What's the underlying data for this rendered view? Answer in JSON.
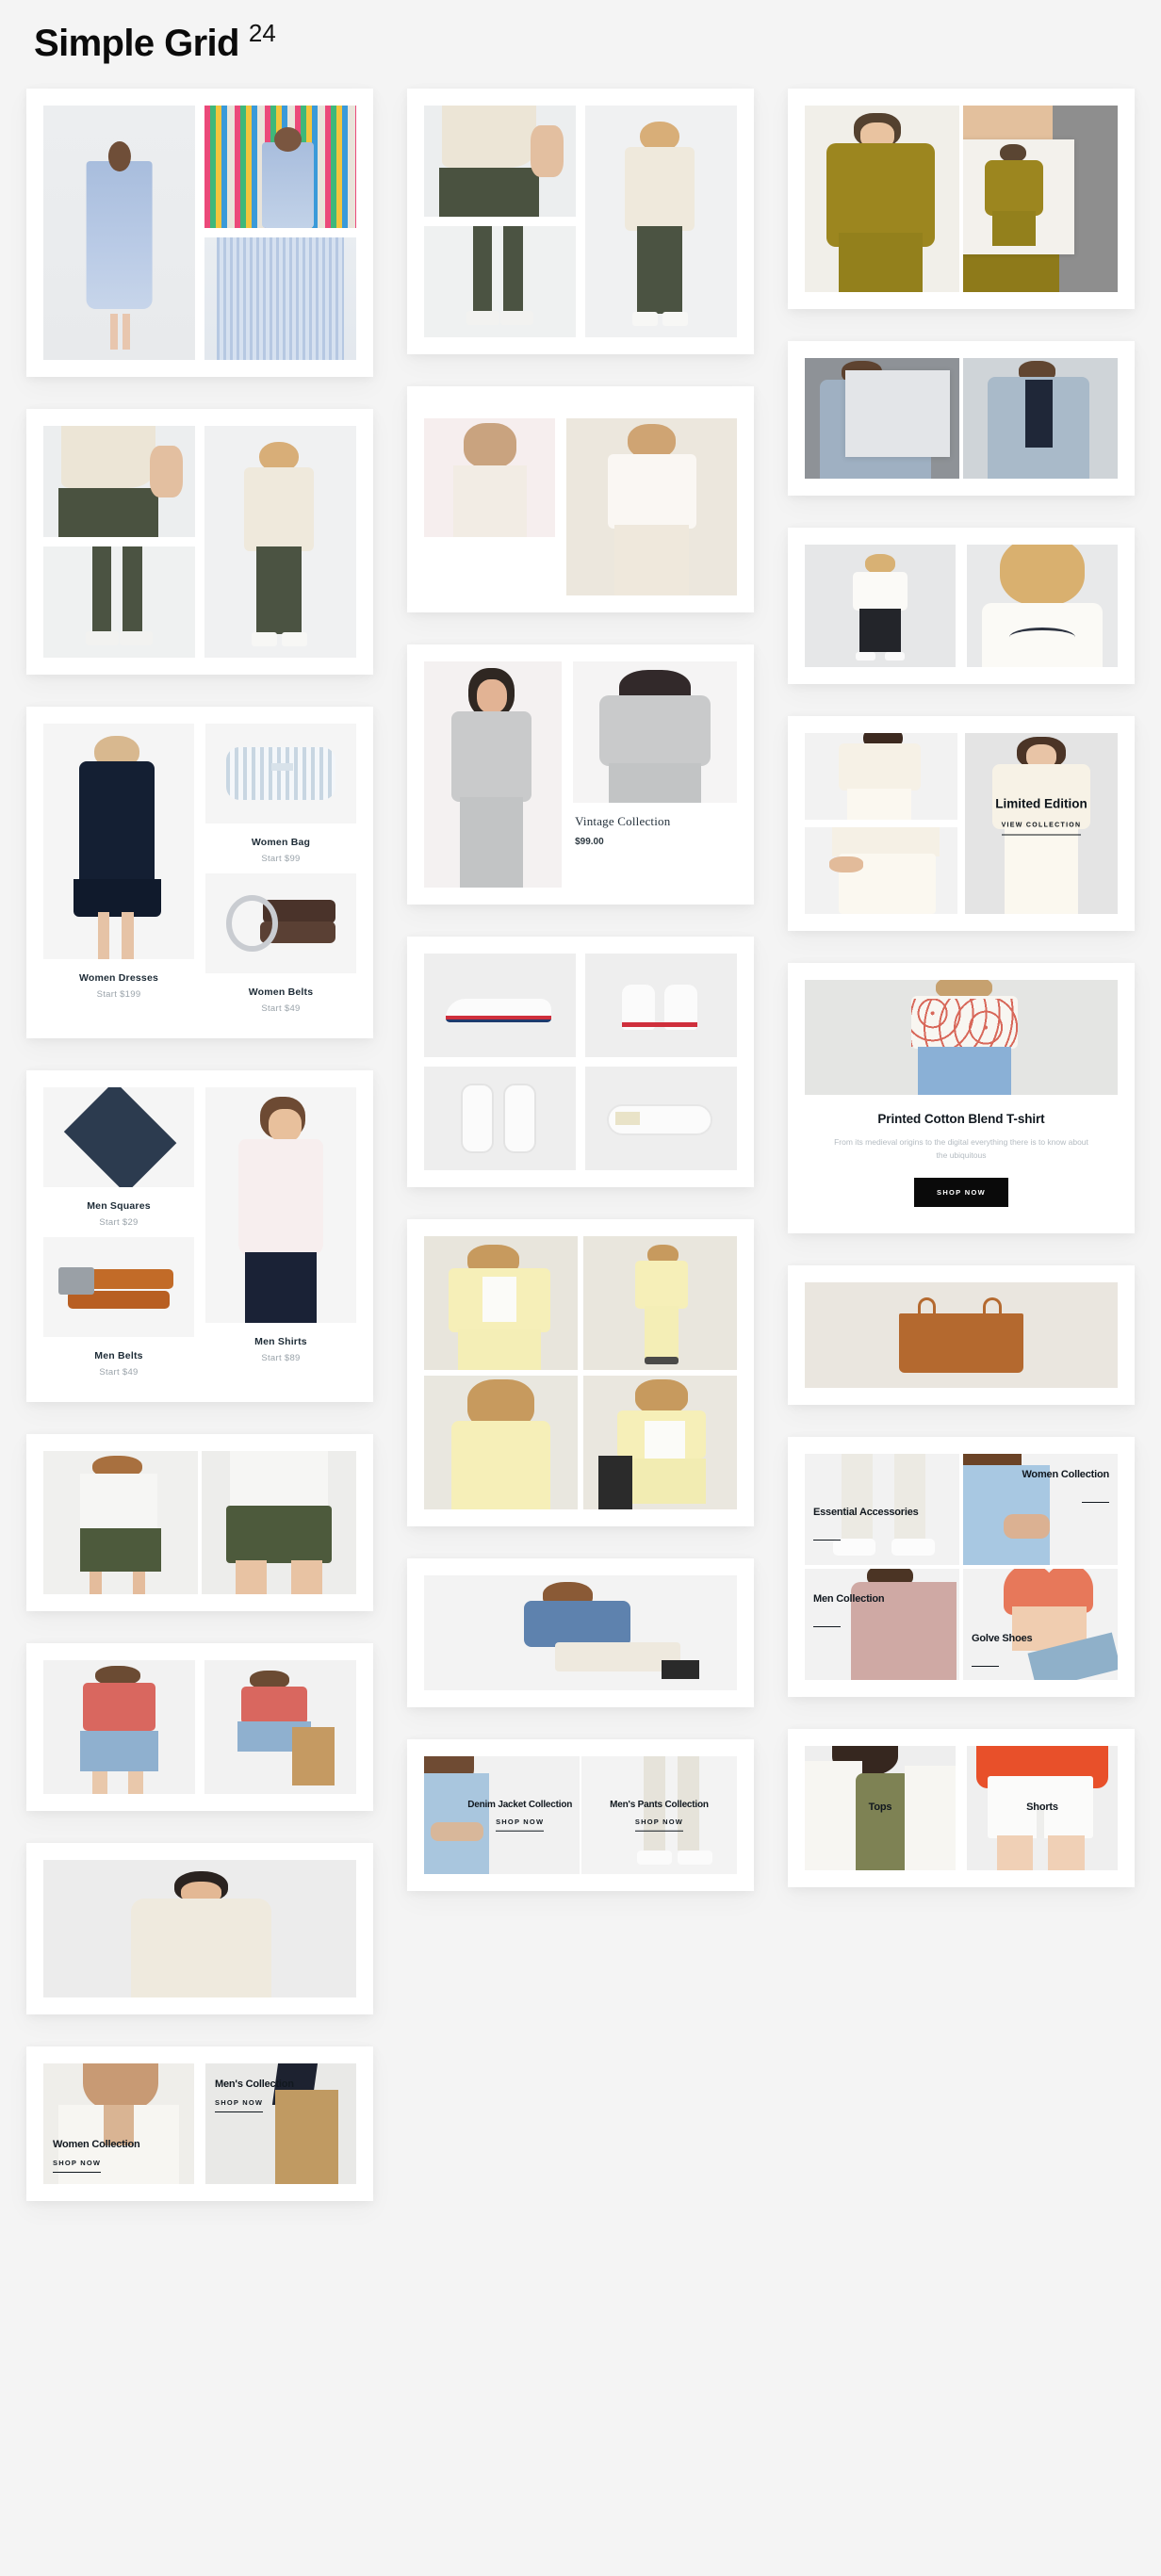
{
  "header": {
    "title": "Simple Grid",
    "superscript": "24"
  },
  "theme": {
    "page_background": "#f4f4f4",
    "card_background": "#ffffff",
    "text_primary": "#11181f",
    "text_muted": "#9aa3aa",
    "button_background": "#0a0a0a",
    "button_text": "#ffffff"
  },
  "columns": [
    {
      "name": "column-1",
      "cards": [
        {
          "id": "girls-dress-gallery",
          "layout": "split-left-tall"
        },
        {
          "id": "boys-olive-pants-gallery",
          "layout": "split-left-stack"
        },
        {
          "id": "women-essentials",
          "layout": "captioned-trio",
          "items": [
            {
              "title": "Women Dresses",
              "price": "Start $199"
            },
            {
              "title": "Women Bag",
              "price": "Start $99"
            },
            {
              "title": "Women Belts",
              "price": "Start $49"
            }
          ]
        },
        {
          "id": "men-essentials",
          "layout": "captioned-trio",
          "items": [
            {
              "title": "Men Squares",
              "price": "Start $29"
            },
            {
              "title": "Men Belts",
              "price": "Start $49"
            },
            {
              "title": "Men Shirts",
              "price": "Start $89"
            }
          ]
        },
        {
          "id": "olive-shorts-pair",
          "layout": "two-up"
        },
        {
          "id": "denim-skirt-pair",
          "layout": "two-up"
        },
        {
          "id": "cream-hoodie-single",
          "layout": "single"
        },
        {
          "id": "collection-split-women-men",
          "layout": "two-up-overlay",
          "items": [
            {
              "title": "Women Collection",
              "link": "SHOP NOW"
            },
            {
              "title": "Men's Collection",
              "link": "SHOP NOW"
            }
          ]
        }
      ]
    },
    {
      "name": "column-2",
      "cards": [
        {
          "id": "olive-pants-gallery-alt",
          "layout": "split-stack-right"
        },
        {
          "id": "blush-blouse-pair",
          "layout": "two-up-uneven"
        },
        {
          "id": "vintage-collection",
          "layout": "image-plus-caption",
          "title": "Vintage Collection",
          "price": "$99.00"
        },
        {
          "id": "white-sneakers-grid",
          "layout": "grid-2x2"
        },
        {
          "id": "yellow-suit-grid",
          "layout": "grid-2x2"
        },
        {
          "id": "blue-sweater-single",
          "layout": "single"
        },
        {
          "id": "collection-split-denim-pants",
          "layout": "two-up-overlay",
          "items": [
            {
              "title": "Denim Jacket Collection",
              "link": "SHOP NOW"
            },
            {
              "title": "Men's Pants Collection",
              "link": "SHOP NOW"
            }
          ]
        }
      ]
    },
    {
      "name": "column-3",
      "cards": [
        {
          "id": "olive-wrap-dress",
          "layout": "two-up-inset"
        },
        {
          "id": "grey-blazer-men",
          "layout": "two-up-inset"
        },
        {
          "id": "kids-white-tee-pair",
          "layout": "two-up"
        },
        {
          "id": "limited-edition",
          "layout": "limited-edition",
          "title": "Limited Edition",
          "link": "VIEW COLLECTION"
        },
        {
          "id": "printed-cotton-blend-tshirt",
          "layout": "promo",
          "title": "Printed Cotton Blend T-shirt",
          "description": "From its medieval origins to the digital everything there is to know about the ubiquitous",
          "button": "SHOP NOW"
        },
        {
          "id": "tan-tote-bag-single",
          "layout": "single"
        },
        {
          "id": "collection-quad",
          "layout": "grid-2x2-overlay",
          "items": [
            {
              "title": "Essential Accessories"
            },
            {
              "title": "Women Collection"
            },
            {
              "title": "Men Collection"
            },
            {
              "title": "Golve Shoes"
            }
          ]
        },
        {
          "id": "tops-shorts-split",
          "layout": "two-up-overlay-center",
          "items": [
            {
              "title": "Tops"
            },
            {
              "title": "Shorts"
            }
          ]
        }
      ]
    }
  ]
}
